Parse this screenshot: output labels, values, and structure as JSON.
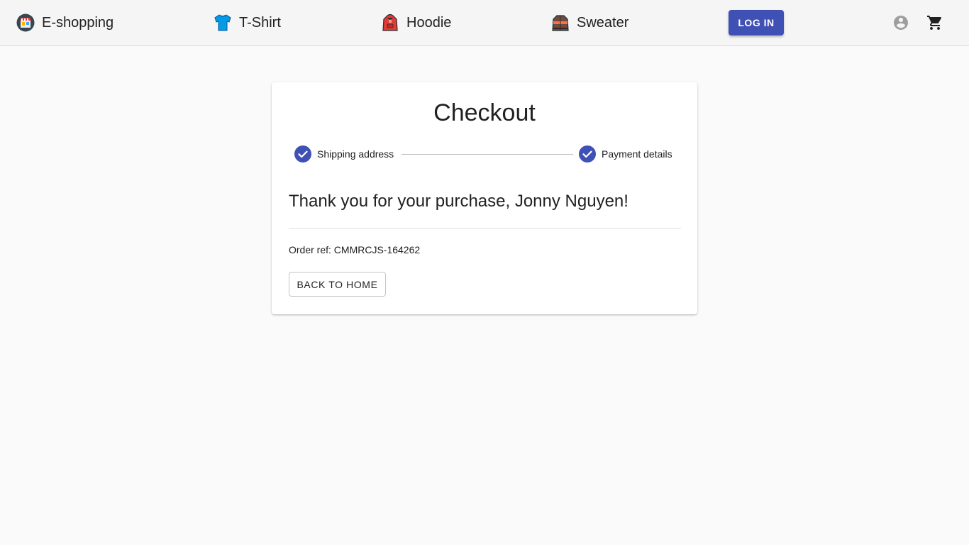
{
  "nav": {
    "items": [
      {
        "label": "E-shopping",
        "icon": "store-icon"
      },
      {
        "label": "T-Shirt",
        "icon": "tshirt-icon"
      },
      {
        "label": "Hoodie",
        "icon": "hoodie-icon"
      },
      {
        "label": "Sweater",
        "icon": "sweater-icon"
      }
    ],
    "login_label": "LOG IN",
    "account_icon": "account-circle-icon",
    "cart_icon": "shopping-cart-icon"
  },
  "colors": {
    "primary": "#3f51b5",
    "background": "#fafafa",
    "appbar": "#f5f5f5"
  },
  "checkout": {
    "title": "Checkout",
    "steps": [
      {
        "label": "Shipping address",
        "completed": true
      },
      {
        "label": "Payment details",
        "completed": true
      }
    ],
    "thanks_message": "Thank you for your purchase, Jonny Nguyen!",
    "order_ref": "Order ref: CMMRCJS-164262",
    "back_button_label": "BACK TO HOME"
  }
}
